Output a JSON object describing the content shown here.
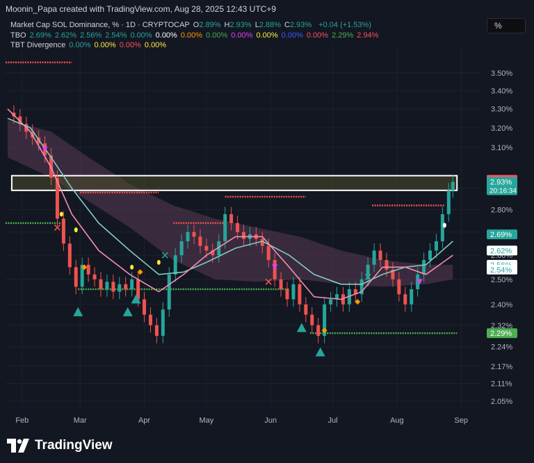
{
  "header": {
    "title": "Moonin_Papa created with TradingView.com, Aug 28, 2025 12:43 UTC+9",
    "symbol": "Market Cap SOL Dominance, % · 1D · CRYPTOCAP",
    "ohlc": [
      {
        "key": "O",
        "val": "2.89%"
      },
      {
        "key": "H",
        "val": "2.93%"
      },
      {
        "key": "L",
        "val": "2.88%"
      },
      {
        "key": "C",
        "val": "2.93%"
      }
    ],
    "change": "+0.04 (+1.53%)",
    "pct_button": "%"
  },
  "legend_tbo": {
    "label": "TBO",
    "values": [
      {
        "v": "2.69%",
        "color": "#26a69a"
      },
      {
        "v": "2.62%",
        "color": "#26a69a"
      },
      {
        "v": "2.56%",
        "color": "#26a69a"
      },
      {
        "v": "2.54%",
        "color": "#26a69a"
      },
      {
        "v": "0.00%",
        "color": "#26a69a"
      },
      {
        "v": "0.00%",
        "color": "#ffffff"
      },
      {
        "v": "0.00%",
        "color": "#ff9800"
      },
      {
        "v": "0.00%",
        "color": "#4caf50"
      },
      {
        "v": "0.00%",
        "color": "#e040fb"
      },
      {
        "v": "0.00%",
        "color": "#ffeb3b"
      },
      {
        "v": "0.00%",
        "color": "#3d5afe"
      },
      {
        "v": "0.00%",
        "color": "#f7525f"
      },
      {
        "v": "2.29%",
        "color": "#4caf50"
      },
      {
        "v": "2.94%",
        "color": "#f7525f"
      }
    ]
  },
  "legend_tbt": {
    "label": "TBT Divergence",
    "values": [
      {
        "v": "0.00%",
        "color": "#26a69a"
      },
      {
        "v": "0.00%",
        "color": "#ffeb3b"
      },
      {
        "v": "0.00%",
        "color": "#f7525f"
      },
      {
        "v": "0.00%",
        "color": "#ffeb3b"
      }
    ]
  },
  "colors": {
    "up": "#26a69a",
    "down": "#ef5350",
    "grid": "#1e222d",
    "background": "#131722",
    "ma_fast": "#f48fb1",
    "ma_slow": "#80cbc4",
    "cloud": "#5b3a55",
    "support": "#4caf50",
    "resistance": "#ef5350"
  },
  "chart_data": {
    "type": "candlestick",
    "y_axis": {
      "scale": "log",
      "ticks": [
        "3.50%",
        "3.40%",
        "3.30%",
        "3.20%",
        "3.10%",
        "2.90%",
        "2.80%",
        "2.70%",
        "2.60%",
        "2.50%",
        "2.40%",
        "2.32%",
        "2.24%",
        "2.17%",
        "2.11%",
        "2.05%"
      ],
      "range": [
        2.02,
        3.62
      ]
    },
    "x_axis": {
      "ticks": [
        "Feb",
        "Mar",
        "Apr",
        "May",
        "Jun",
        "Jul",
        "Aug",
        "Sep"
      ],
      "range": [
        "2025-01-24",
        "2025-09-10"
      ]
    },
    "price_labels": [
      {
        "text": "2.94%",
        "value": 2.94,
        "bg": "#f7525f",
        "fg": "#ffffff"
      },
      {
        "text": "2.93%",
        "value": 2.93,
        "bg": "#26a69a",
        "fg": "#ffffff",
        "sub": "20:16:34"
      },
      {
        "text": "2.69%",
        "value": 2.69,
        "bg": "#26a69a",
        "fg": "#ffffff"
      },
      {
        "text": "2.62%",
        "value": 2.62,
        "bg": "#ffffff",
        "fg": "#26a69a"
      },
      {
        "text": "2.56%",
        "value": 2.56,
        "bg": "#ffffff",
        "fg": "#26a69a"
      },
      {
        "text": "2.54%",
        "value": 2.54,
        "bg": "#ffffff",
        "fg": "#26a69a"
      },
      {
        "text": "2.29%",
        "value": 2.29,
        "bg": "#4caf50",
        "fg": "#ffffff"
      }
    ],
    "highlight_zone": {
      "x1": "2025-01-27",
      "x2": "2025-08-30",
      "y_low": 2.89,
      "y_high": 2.96
    },
    "close_series": [
      [
        "2025-01-25",
        3.28
      ],
      [
        "2025-01-28",
        3.26
      ],
      [
        "2025-01-31",
        3.22
      ],
      [
        "2025-02-03",
        3.18
      ],
      [
        "2025-02-06",
        3.15
      ],
      [
        "2025-02-09",
        3.12
      ],
      [
        "2025-02-12",
        3.06
      ],
      [
        "2025-02-15",
        2.95
      ],
      [
        "2025-02-18",
        2.76
      ],
      [
        "2025-02-21",
        2.65
      ],
      [
        "2025-02-24",
        2.55
      ],
      [
        "2025-02-27",
        2.47
      ],
      [
        "2025-03-02",
        2.56
      ],
      [
        "2025-03-05",
        2.52
      ],
      [
        "2025-03-08",
        2.5
      ],
      [
        "2025-03-11",
        2.46
      ],
      [
        "2025-03-14",
        2.49
      ],
      [
        "2025-03-17",
        2.45
      ],
      [
        "2025-03-20",
        2.48
      ],
      [
        "2025-03-23",
        2.46
      ],
      [
        "2025-03-26",
        2.5
      ],
      [
        "2025-03-29",
        2.42
      ],
      [
        "2025-04-01",
        2.36
      ],
      [
        "2025-04-04",
        2.32
      ],
      [
        "2025-04-07",
        2.28
      ],
      [
        "2025-04-10",
        2.38
      ],
      [
        "2025-04-13",
        2.52
      ],
      [
        "2025-04-16",
        2.6
      ],
      [
        "2025-04-19",
        2.66
      ],
      [
        "2025-04-22",
        2.7
      ],
      [
        "2025-04-25",
        2.68
      ],
      [
        "2025-04-28",
        2.64
      ],
      [
        "2025-05-01",
        2.62
      ],
      [
        "2025-05-04",
        2.6
      ],
      [
        "2025-05-07",
        2.66
      ],
      [
        "2025-05-10",
        2.78
      ],
      [
        "2025-05-13",
        2.74
      ],
      [
        "2025-05-16",
        2.7
      ],
      [
        "2025-05-19",
        2.67
      ],
      [
        "2025-05-22",
        2.69
      ],
      [
        "2025-05-25",
        2.67
      ],
      [
        "2025-05-28",
        2.64
      ],
      [
        "2025-05-31",
        2.58
      ],
      [
        "2025-06-03",
        2.5
      ],
      [
        "2025-06-06",
        2.46
      ],
      [
        "2025-06-09",
        2.42
      ],
      [
        "2025-06-12",
        2.48
      ],
      [
        "2025-06-15",
        2.4
      ],
      [
        "2025-06-18",
        2.36
      ],
      [
        "2025-06-21",
        2.32
      ],
      [
        "2025-06-24",
        2.28
      ],
      [
        "2025-06-27",
        2.4
      ],
      [
        "2025-06-30",
        2.42
      ],
      [
        "2025-07-03",
        2.44
      ],
      [
        "2025-07-06",
        2.4
      ],
      [
        "2025-07-09",
        2.46
      ],
      [
        "2025-07-12",
        2.44
      ],
      [
        "2025-07-15",
        2.5
      ],
      [
        "2025-07-18",
        2.56
      ],
      [
        "2025-07-21",
        2.62
      ],
      [
        "2025-07-24",
        2.58
      ],
      [
        "2025-07-27",
        2.54
      ],
      [
        "2025-07-30",
        2.5
      ],
      [
        "2025-08-02",
        2.44
      ],
      [
        "2025-08-05",
        2.4
      ],
      [
        "2025-08-08",
        2.46
      ],
      [
        "2025-08-11",
        2.52
      ],
      [
        "2025-08-14",
        2.58
      ],
      [
        "2025-08-17",
        2.62
      ],
      [
        "2025-08-20",
        2.66
      ],
      [
        "2025-08-23",
        2.78
      ],
      [
        "2025-08-26",
        2.89
      ],
      [
        "2025-08-28",
        2.93
      ]
    ],
    "ma_fast": [
      [
        "2025-01-25",
        3.3
      ],
      [
        "2025-02-05",
        3.18
      ],
      [
        "2025-02-15",
        3.0
      ],
      [
        "2025-02-25",
        2.78
      ],
      [
        "2025-03-10",
        2.62
      ],
      [
        "2025-03-25",
        2.52
      ],
      [
        "2025-04-08",
        2.45
      ],
      [
        "2025-04-20",
        2.52
      ],
      [
        "2025-05-01",
        2.6
      ],
      [
        "2025-05-15",
        2.68
      ],
      [
        "2025-05-28",
        2.68
      ],
      [
        "2025-06-10",
        2.55
      ],
      [
        "2025-06-22",
        2.43
      ],
      [
        "2025-07-05",
        2.42
      ],
      [
        "2025-07-15",
        2.45
      ],
      [
        "2025-07-25",
        2.55
      ],
      [
        "2025-08-05",
        2.55
      ],
      [
        "2025-08-15",
        2.52
      ],
      [
        "2025-08-28",
        2.6
      ]
    ],
    "ma_slow": [
      [
        "2025-01-25",
        3.25
      ],
      [
        "2025-02-05",
        3.2
      ],
      [
        "2025-02-15",
        3.05
      ],
      [
        "2025-02-25",
        2.9
      ],
      [
        "2025-03-10",
        2.74
      ],
      [
        "2025-03-25",
        2.62
      ],
      [
        "2025-04-08",
        2.52
      ],
      [
        "2025-04-20",
        2.53
      ],
      [
        "2025-05-01",
        2.57
      ],
      [
        "2025-05-15",
        2.63
      ],
      [
        "2025-05-28",
        2.66
      ],
      [
        "2025-06-10",
        2.6
      ],
      [
        "2025-06-22",
        2.52
      ],
      [
        "2025-07-05",
        2.48
      ],
      [
        "2025-07-15",
        2.48
      ],
      [
        "2025-07-25",
        2.52
      ],
      [
        "2025-08-05",
        2.55
      ],
      [
        "2025-08-15",
        2.56
      ],
      [
        "2025-08-28",
        2.66
      ]
    ],
    "cloud_upper": [
      [
        "2025-01-25",
        3.24
      ],
      [
        "2025-02-15",
        3.18
      ],
      [
        "2025-03-05",
        3.05
      ],
      [
        "2025-03-25",
        2.92
      ],
      [
        "2025-04-15",
        2.82
      ],
      [
        "2025-05-05",
        2.76
      ],
      [
        "2025-05-25",
        2.72
      ],
      [
        "2025-06-15",
        2.68
      ],
      [
        "2025-07-05",
        2.62
      ],
      [
        "2025-07-25",
        2.58
      ],
      [
        "2025-08-15",
        2.56
      ],
      [
        "2025-08-28",
        2.56
      ]
    ],
    "cloud_lower": [
      [
        "2025-01-25",
        3.05
      ],
      [
        "2025-02-15",
        2.95
      ],
      [
        "2025-03-05",
        2.84
      ],
      [
        "2025-03-25",
        2.72
      ],
      [
        "2025-04-15",
        2.58
      ],
      [
        "2025-05-05",
        2.5
      ],
      [
        "2025-05-25",
        2.49
      ],
      [
        "2025-06-15",
        2.5
      ],
      [
        "2025-07-05",
        2.48
      ],
      [
        "2025-07-25",
        2.47
      ],
      [
        "2025-08-15",
        2.48
      ],
      [
        "2025-08-28",
        2.5
      ]
    ],
    "resistance_lines": [
      {
        "x1": "2025-01-24",
        "x2": "2025-02-25",
        "y": 3.56
      },
      {
        "x1": "2025-03-01",
        "x2": "2025-04-08",
        "y": 2.88
      },
      {
        "x1": "2025-04-15",
        "x2": "2025-05-10",
        "y": 2.74
      },
      {
        "x1": "2025-05-10",
        "x2": "2025-06-18",
        "y": 2.86
      },
      {
        "x1": "2025-07-20",
        "x2": "2025-08-24",
        "y": 2.82
      }
    ],
    "support_lines": [
      {
        "x1": "2025-01-24",
        "x2": "2025-02-20",
        "y": 2.74
      },
      {
        "x1": "2025-02-28",
        "x2": "2025-06-10",
        "y": 2.46
      },
      {
        "x1": "2025-06-20",
        "x2": "2025-08-30",
        "y": 2.29
      }
    ],
    "markers": [
      {
        "d": "2025-02-28",
        "v": 2.37,
        "shape": "triangle-up",
        "color": "#26a69a"
      },
      {
        "d": "2025-03-24",
        "v": 2.37,
        "shape": "triangle-up",
        "color": "#26a69a"
      },
      {
        "d": "2025-03-28",
        "v": 2.42,
        "shape": "triangle-up",
        "color": "#26a69a"
      },
      {
        "d": "2025-06-16",
        "v": 2.31,
        "shape": "triangle-up",
        "color": "#26a69a"
      },
      {
        "d": "2025-06-25",
        "v": 2.22,
        "shape": "triangle-up",
        "color": "#26a69a"
      },
      {
        "d": "2025-02-12",
        "v": 3.09,
        "shape": "triangle-down",
        "color": "#e040fb"
      },
      {
        "d": "2025-06-03",
        "v": 2.55,
        "shape": "triangle-down",
        "color": "#e040fb"
      },
      {
        "d": "2025-08-12",
        "v": 2.49,
        "shape": "triangle-down",
        "color": "#e040fb"
      },
      {
        "d": "2025-02-20",
        "v": 2.78,
        "shape": "dot",
        "color": "#ffeb3b"
      },
      {
        "d": "2025-02-27",
        "v": 2.71,
        "shape": "dot",
        "color": "#ffeb3b"
      },
      {
        "d": "2025-03-26",
        "v": 2.55,
        "shape": "dot",
        "color": "#ffeb3b"
      },
      {
        "d": "2025-04-08",
        "v": 2.57,
        "shape": "dot",
        "color": "#ffeb3b"
      },
      {
        "d": "2025-08-24",
        "v": 2.73,
        "shape": "dot",
        "color": "#ffffff"
      },
      {
        "d": "2025-03-03",
        "v": 2.55,
        "shape": "diamond",
        "color": "#ff9800"
      },
      {
        "d": "2025-03-30",
        "v": 2.53,
        "shape": "diamond",
        "color": "#ff9800"
      },
      {
        "d": "2025-06-27",
        "v": 2.3,
        "shape": "diamond",
        "color": "#ff9800"
      },
      {
        "d": "2025-07-13",
        "v": 2.41,
        "shape": "diamond",
        "color": "#ff9800"
      },
      {
        "d": "2025-02-18",
        "v": 2.72,
        "shape": "x",
        "color": "#ef5350"
      },
      {
        "d": "2025-05-31",
        "v": 2.49,
        "shape": "x",
        "color": "#ef5350"
      },
      {
        "d": "2025-04-11",
        "v": 2.6,
        "shape": "x",
        "color": "#26a69a"
      },
      {
        "d": "2025-07-18",
        "v": 2.51,
        "shape": "x",
        "color": "#26a69a"
      }
    ]
  },
  "footer": {
    "brand": "TradingView"
  }
}
